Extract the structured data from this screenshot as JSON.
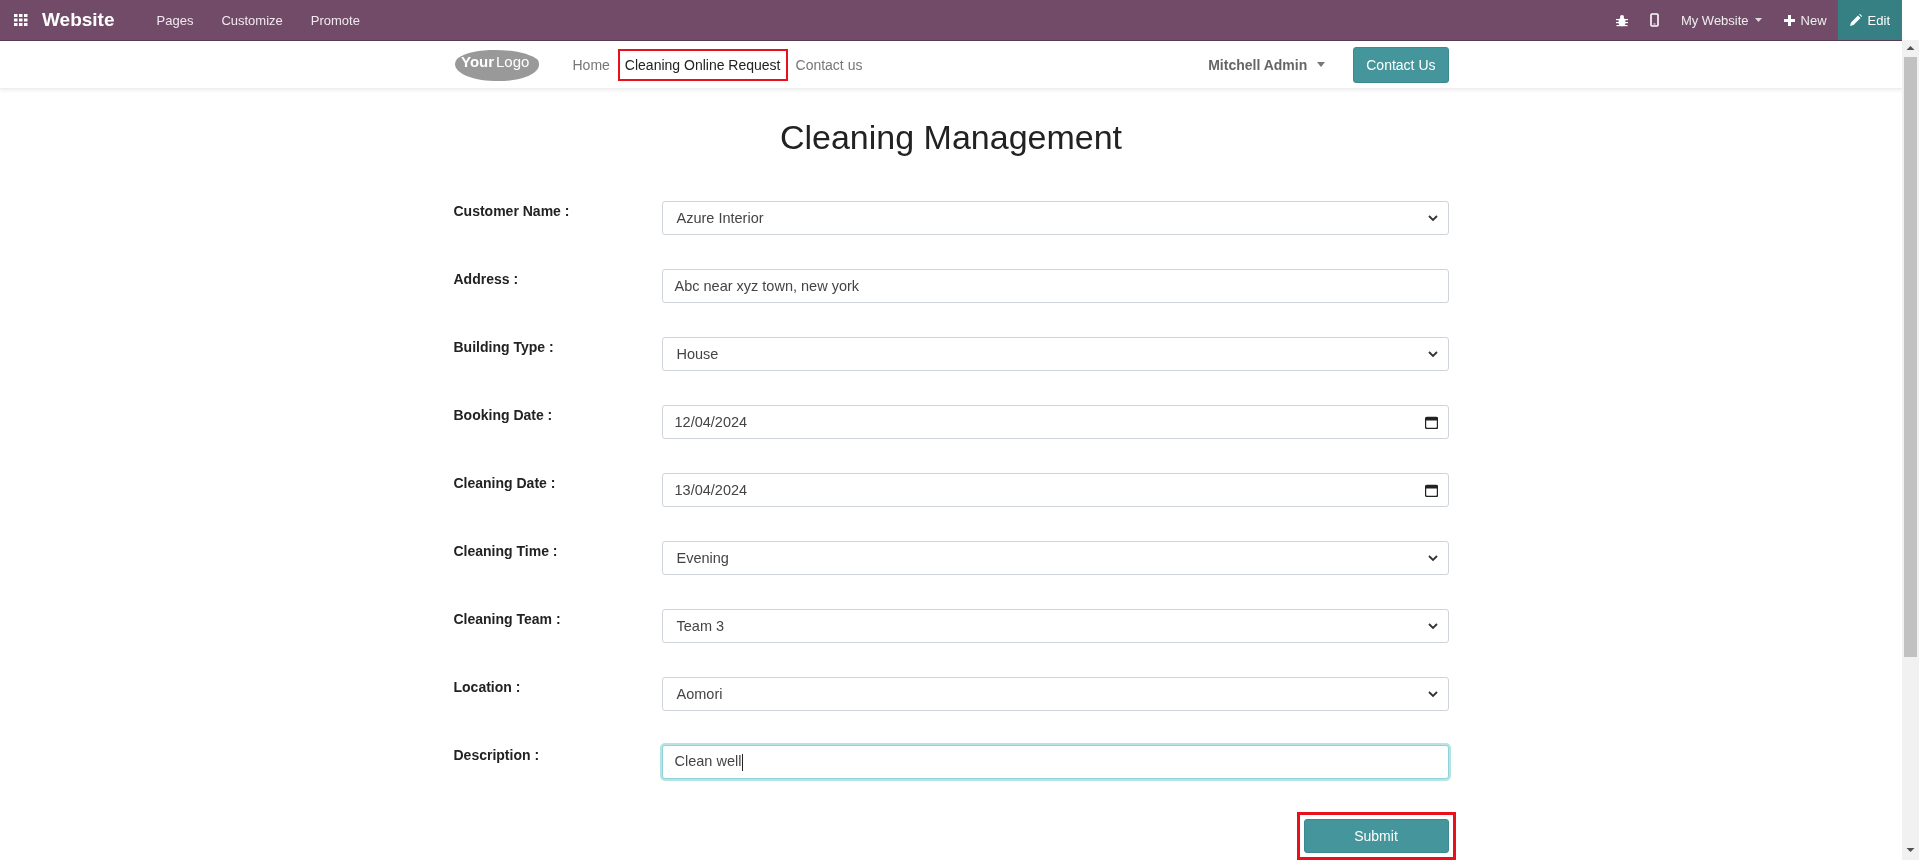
{
  "top_bar": {
    "app_title": "Website",
    "menu": [
      "Pages",
      "Customize",
      "Promote"
    ],
    "website_switcher": "My Website",
    "new_button": "New",
    "edit_button": "Edit"
  },
  "site_nav": {
    "logo": [
      "Your",
      "Logo"
    ],
    "items": [
      {
        "label": "Home",
        "selected": false,
        "highlighted": false
      },
      {
        "label": "Cleaning Online Request",
        "selected": true,
        "highlighted": true
      },
      {
        "label": "Contact us",
        "selected": false,
        "highlighted": false
      }
    ],
    "user": "Mitchell Admin",
    "contact_button": "Contact Us"
  },
  "form": {
    "title": "Cleaning Management",
    "fields": [
      {
        "label": "Customer Name :",
        "kind": "select",
        "value": "Azure Interior",
        "focused": false
      },
      {
        "label": "Address :",
        "kind": "text",
        "value": "Abc near xyz town, new york",
        "focused": false
      },
      {
        "label": "Building Type :",
        "kind": "select",
        "value": "House",
        "focused": false
      },
      {
        "label": "Booking Date :",
        "kind": "date",
        "value": "12/04/2024",
        "focused": false
      },
      {
        "label": "Cleaning Date :",
        "kind": "date",
        "value": "13/04/2024",
        "focused": false
      },
      {
        "label": "Cleaning Time :",
        "kind": "select",
        "value": "Evening",
        "focused": false
      },
      {
        "label": "Cleaning Team :",
        "kind": "select",
        "value": "Team 3",
        "focused": false
      },
      {
        "label": "Location :",
        "kind": "select",
        "value": "Aomori",
        "focused": false
      },
      {
        "label": "Description :",
        "kind": "text",
        "value": "Clean well",
        "focused": true
      }
    ],
    "submit": {
      "label": "Submit",
      "highlighted": true
    }
  }
}
